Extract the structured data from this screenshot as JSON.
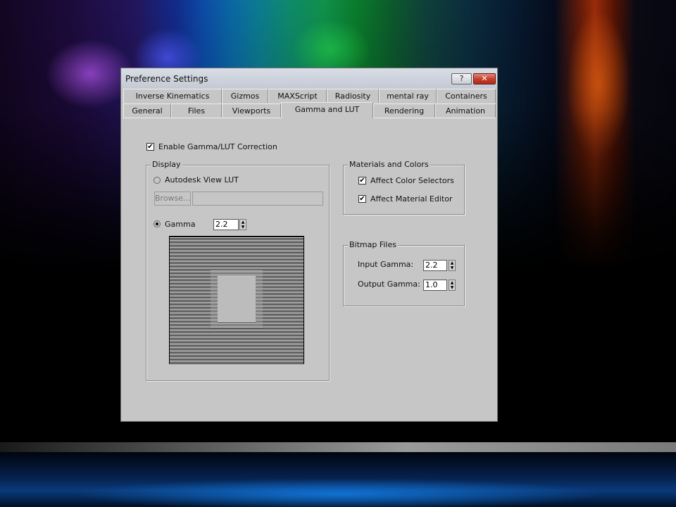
{
  "window": {
    "title": "Preference Settings",
    "help_label": "?",
    "close_label": "✕"
  },
  "tabs": {
    "row1": [
      "Inverse Kinematics",
      "Gizmos",
      "MAXScript",
      "Radiosity",
      "mental ray",
      "Containers"
    ],
    "row2": [
      "General",
      "Files",
      "Viewports",
      "Gamma and LUT",
      "Rendering",
      "Animation"
    ],
    "active": "Gamma and LUT"
  },
  "enable_gamma": {
    "label": "Enable Gamma/LUT Correction",
    "checked": true
  },
  "display": {
    "title": "Display",
    "lut_label": "Autodesk View LUT",
    "lut_selected": false,
    "browse_label": "Browse...",
    "lut_path": "",
    "gamma_label": "Gamma",
    "gamma_selected": true,
    "gamma_value": "2.2"
  },
  "materials": {
    "title": "Materials and Colors",
    "affect_color_selectors": {
      "label": "Affect Color Selectors",
      "checked": true
    },
    "affect_material_editor": {
      "label": "Affect Material Editor",
      "checked": true
    }
  },
  "bitmap": {
    "title": "Bitmap Files",
    "input_label": "Input Gamma:",
    "input_value": "2.2",
    "output_label": "Output Gamma:",
    "output_value": "1.0"
  },
  "check_mark": "✔"
}
